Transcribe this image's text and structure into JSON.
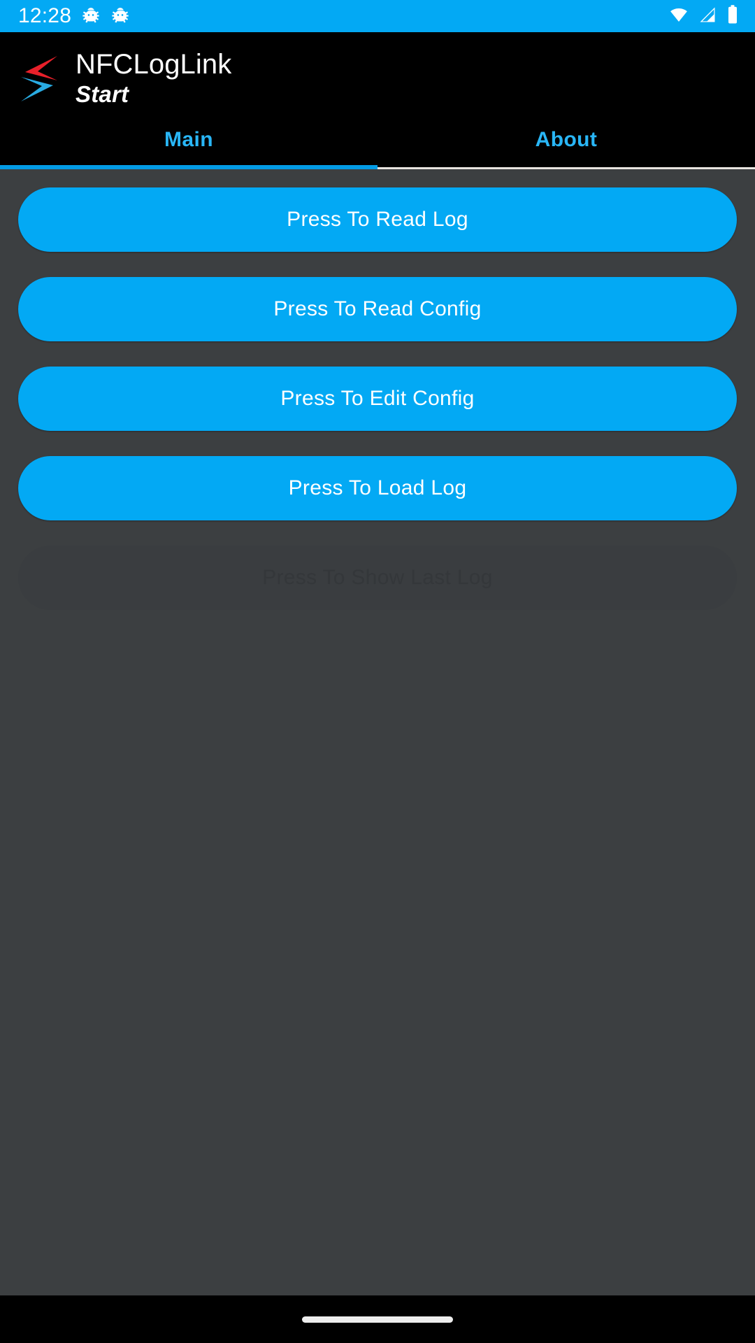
{
  "status_bar": {
    "clock": "12:28",
    "left_icons": [
      "bug-icon",
      "bug-icon"
    ],
    "right_icons": [
      "wifi-icon",
      "cell-signal-icon",
      "battery-icon"
    ],
    "background_color": "#03A9F4"
  },
  "app_bar": {
    "logo_name": "nfcloglink-logo",
    "logo_colors": {
      "top_chevron": "#E8202A",
      "bottom_chevron": "#29ABE2"
    },
    "title": "NFCLogLink",
    "subtitle": "Start",
    "background_color": "#000000"
  },
  "tabs": {
    "active_index": 0,
    "accent_color": "#29B6F6",
    "items": [
      {
        "label": "Main",
        "active": true
      },
      {
        "label": "About",
        "active": false
      }
    ]
  },
  "main": {
    "background_color": "#3C3F41",
    "buttons": [
      {
        "label": "Press To Read Log",
        "enabled": true
      },
      {
        "label": "Press To Read Config",
        "enabled": true
      },
      {
        "label": "Press To Edit Config",
        "enabled": true
      },
      {
        "label": "Press To Load Log",
        "enabled": true
      },
      {
        "label": "Press To Show Last Log",
        "enabled": false
      }
    ],
    "button_color": "#03A9F4",
    "button_disabled_color": "#3A3D40"
  },
  "nav_bar": {
    "gesture_pill": "home-gesture-pill",
    "background_color": "#000000"
  }
}
